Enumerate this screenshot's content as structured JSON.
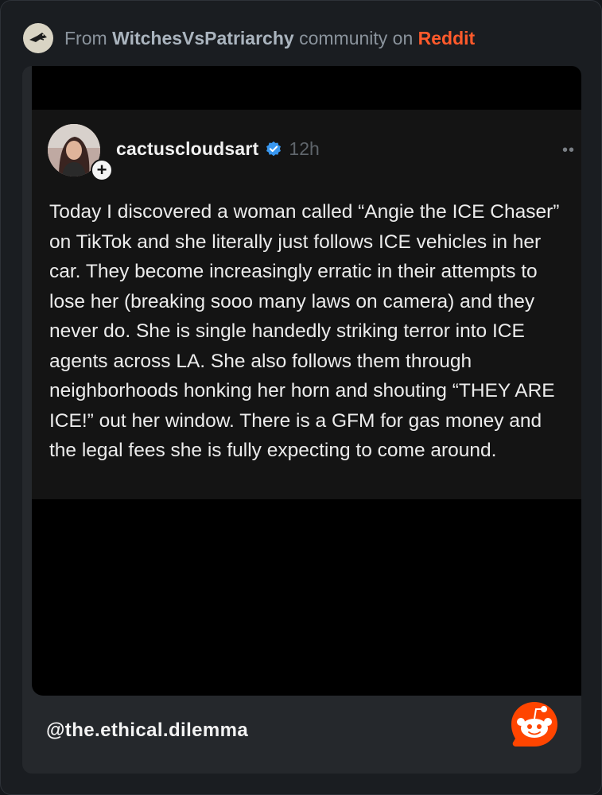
{
  "header": {
    "prefix": "From",
    "community": "WitchesVsPatriarchy",
    "middle": "community on",
    "platform": "Reddit",
    "avatar_icon": "witch-hat-bird-icon"
  },
  "post": {
    "username": "cactuscloudsart",
    "verified_icon": "verified-badge-icon",
    "timestamp": "12h",
    "more_icon": "ellipsis-icon",
    "follow_icon": "plus-icon",
    "follow_symbol": "+",
    "more_symbol": "••",
    "body": "Today I discovered a woman called “Angie the ICE Chaser” on TikTok and she literally just follows ICE vehicles in her car. They become increasingly erratic in their attempts to lose her (breaking sooo many laws on camera) and they never do. She is single handedly striking terror into ICE agents across LA. She also follows them through neighborhoods honking her horn and shouting “THEY ARE ICE!” out her window. There is a GFM for gas money and the legal fees she is fully expecting to come around."
  },
  "footer": {
    "handle": "@the.ethical.dilemma",
    "logo_icon": "reddit-snoo-icon"
  },
  "colors": {
    "reddit_orange": "#ff5a2b",
    "verified_blue": "#3897f0"
  }
}
